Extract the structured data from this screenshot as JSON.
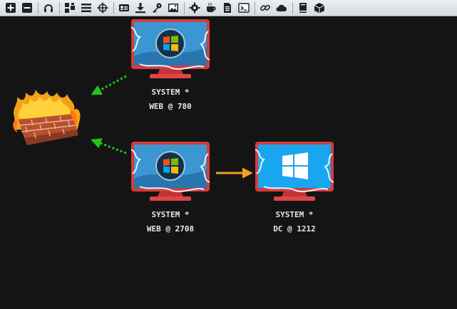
{
  "toolbar": {
    "buttons": [
      {
        "icon": "plus-icon"
      },
      {
        "icon": "minus-icon"
      },
      {
        "sep": true
      },
      {
        "icon": "headphones-icon"
      },
      {
        "sep": true
      },
      {
        "icon": "pivot-graph-icon"
      },
      {
        "icon": "list-icon"
      },
      {
        "icon": "crosshair-icon"
      },
      {
        "sep": true
      },
      {
        "icon": "credentials-icon"
      },
      {
        "icon": "download-icon"
      },
      {
        "icon": "key-icon"
      },
      {
        "icon": "image-icon"
      },
      {
        "sep": true
      },
      {
        "icon": "gear-icon"
      },
      {
        "icon": "coffee-icon"
      },
      {
        "icon": "document-icon"
      },
      {
        "icon": "terminal-icon"
      },
      {
        "sep": true
      },
      {
        "icon": "link-icon"
      },
      {
        "icon": "cloud-icon"
      },
      {
        "sep": true
      },
      {
        "icon": "book-icon"
      },
      {
        "icon": "package-icon"
      }
    ]
  },
  "graph": {
    "nodes": [
      {
        "id": "web780",
        "type": "windows7-session",
        "line1": "SYSTEM *",
        "line2": "WEB @ 780"
      },
      {
        "id": "web2708",
        "type": "windows7-session",
        "line1": "SYSTEM *",
        "line2": "WEB @ 2708"
      },
      {
        "id": "dc1212",
        "type": "windows10-session",
        "line1": "SYSTEM *",
        "line2": "DC @ 1212"
      },
      {
        "id": "firewall",
        "type": "firewall"
      }
    ],
    "edges": [
      {
        "from": "web780",
        "to": "firewall",
        "style": "dotted",
        "color": "#22c322"
      },
      {
        "from": "web2708",
        "to": "firewall",
        "style": "dotted",
        "color": "#22c322"
      },
      {
        "from": "web2708",
        "to": "dc1212",
        "style": "solid",
        "color": "#f0a020"
      }
    ]
  },
  "colors": {
    "canvas_bg": "#141414",
    "label_text": "#e6e6e6",
    "monitor_frame": "#d33c3c",
    "smb_link": "#f0a020",
    "pivot_link": "#22c322"
  }
}
